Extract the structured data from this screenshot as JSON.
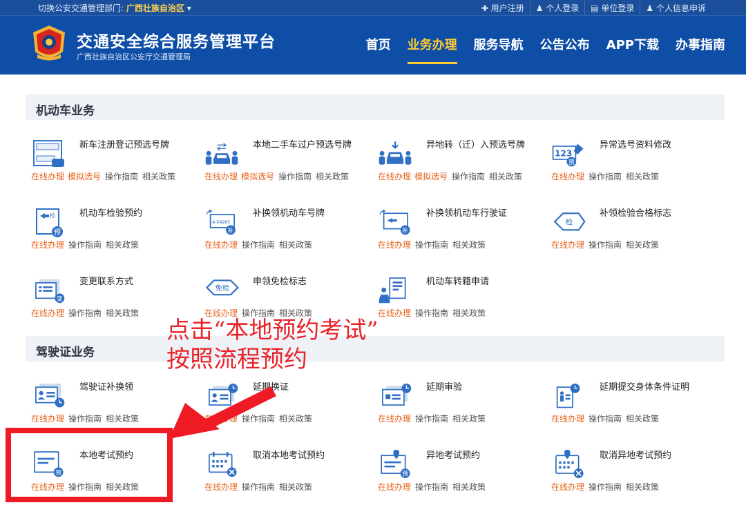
{
  "topbar": {
    "region_prefix": "切换公安交通管理部门:",
    "region_name": "广西壮族自治区",
    "region_caret": "▾",
    "links": [
      "✚ 用户注册",
      "♟ 个人登录",
      "▤ 单位登录",
      "♟ 个人信息申诉"
    ]
  },
  "header": {
    "title": "交通安全综合服务管理平台",
    "subtitle": "广西壮族自治区公安厅交通管理局",
    "nav": [
      "首页",
      "业务办理",
      "服务导航",
      "公告公布",
      "APP下载",
      "办事指南"
    ],
    "active_nav": "业务办理"
  },
  "sections": {
    "vehicle": "机动车业务",
    "license": "驾驶证业务"
  },
  "actions": {
    "online": "在线办理",
    "simulate": "模拟选号",
    "guide": "操作指南",
    "policy": "相关政策"
  },
  "vehicle_items": [
    {
      "title": "新车注册登记预选号牌",
      "icon": "plate-car-icon",
      "sim": true
    },
    {
      "title": "本地二手车过户预选号牌",
      "icon": "transfer-car-icon",
      "sim": true
    },
    {
      "title": "异地转（迁）入预选号牌",
      "icon": "move-in-car-icon",
      "sim": true
    },
    {
      "title": "异常选号资料修改",
      "icon": "edit-number-icon",
      "sim": false
    },
    {
      "title": "机动车检验预约",
      "icon": "inspection-book-icon",
      "sim": false
    },
    {
      "title": "补换领机动车号牌",
      "icon": "plate-replace-icon",
      "sim": false
    },
    {
      "title": "补换领机动车行驶证",
      "icon": "license-replace-icon",
      "sim": false
    },
    {
      "title": "补领检验合格标志",
      "icon": "inspect-badge-icon",
      "sim": false
    },
    {
      "title": "变更联系方式",
      "icon": "change-contact-icon",
      "sim": false
    },
    {
      "title": "申领免检标志",
      "icon": "exempt-badge-icon",
      "sim": false
    },
    {
      "title": "机动车转籍申请",
      "icon": "transfer-register-icon",
      "sim": false
    }
  ],
  "license_items": [
    {
      "title": "驾驶证补换领",
      "icon": "id-card-icon"
    },
    {
      "title": "延期换证",
      "icon": "id-card-clock-icon"
    },
    {
      "title": "延期审验",
      "icon": "review-card-icon"
    },
    {
      "title": "延期提交身体条件证明",
      "icon": "health-doc-icon"
    },
    {
      "title": "本地考试预约",
      "icon": "exam-book-icon"
    },
    {
      "title": "取消本地考试预约",
      "icon": "calendar-cancel-icon"
    },
    {
      "title": "异地考试预约",
      "icon": "remote-exam-icon"
    },
    {
      "title": "取消异地考试预约",
      "icon": "remote-calendar-cancel-icon"
    }
  ],
  "badges": {
    "pre": "预",
    "supp": "补",
    "change": "变",
    "inspect": "检",
    "exempt": "免检",
    "plate_num": "A·D4285",
    "num123": "123"
  },
  "annotation": {
    "line1": "点击“本地预约考试”",
    "line2": "按照流程预约"
  },
  "colors": {
    "primary": "#0f4ea6",
    "accent": "#ffcc33",
    "action": "#e8641e",
    "annotation": "#e8232a"
  }
}
